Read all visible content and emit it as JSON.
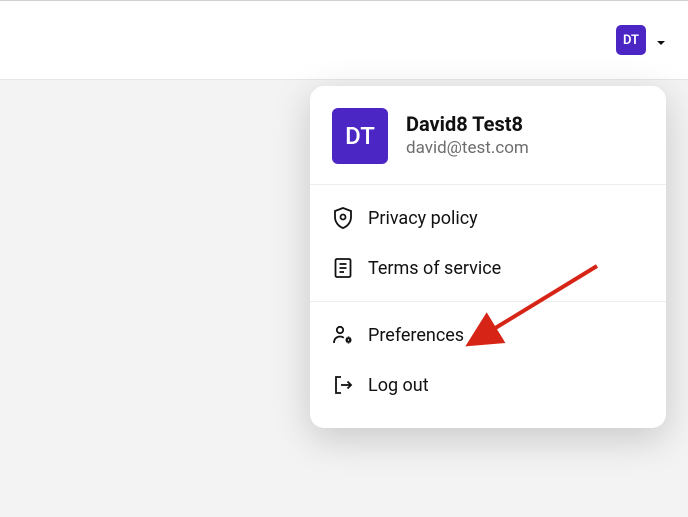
{
  "avatar": {
    "initials": "DT"
  },
  "user": {
    "name": "David8 Test8",
    "email": "david@test.com"
  },
  "menu": {
    "privacy": "Privacy policy",
    "terms": "Terms of service",
    "preferences": "Preferences",
    "logout": "Log out"
  },
  "colors": {
    "accent": "#4b26c4"
  }
}
